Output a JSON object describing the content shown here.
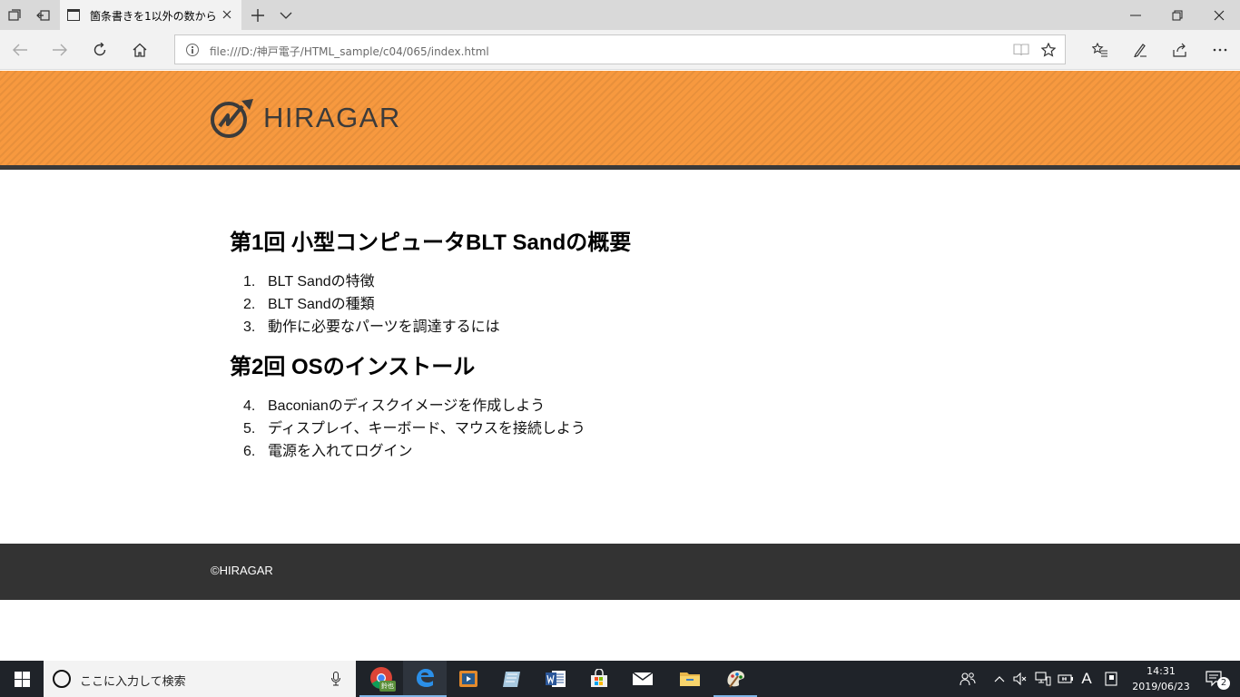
{
  "browser": {
    "tab_title": "箇条書きを1以外の数から",
    "url": "file:///D:/神戸電子/HTML_sample/c04/065/index.html"
  },
  "page": {
    "logo_text": "HIRAGAR",
    "sections": [
      {
        "title": "第1回 小型コンピュータBLT Sandの概要",
        "items": [
          {
            "num": "1.",
            "text": "BLT Sandの特徴"
          },
          {
            "num": "2.",
            "text": "BLT Sandの種類"
          },
          {
            "num": "3.",
            "text": "動作に必要なパーツを調達するには"
          }
        ]
      },
      {
        "title": "第2回 OSのインストール",
        "items": [
          {
            "num": "4.",
            "text": "Baconianのディスクイメージを作成しよう"
          },
          {
            "num": "5.",
            "text": "ディスプレイ、キーボード、マウスを接続しよう"
          },
          {
            "num": "6.",
            "text": "電源を入れてログイン"
          }
        ]
      }
    ],
    "footer_text": "©HIRAGAR"
  },
  "taskbar": {
    "search_placeholder": "ここに入力して検索",
    "chrome_badge": "鈴也",
    "ime_mode": "A",
    "time": "14:31",
    "date": "2019/06/23",
    "notification_count": "2"
  },
  "colors": {
    "header_orange": "#f7993f",
    "header_rule": "#3a3a3a",
    "footer_bg": "#333333",
    "taskbar_bg": "#1f2329"
  }
}
